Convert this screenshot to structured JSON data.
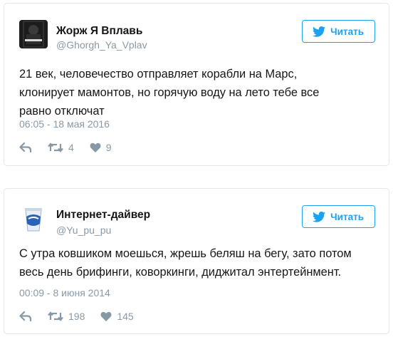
{
  "colors": {
    "accent": "#1da1f2",
    "muted": "#8899a6",
    "text": "#14171a",
    "border": "#e1e8ed"
  },
  "tweets": [
    {
      "name": "Жорж Я Вплавь",
      "handle": "@Ghorgh_Ya_Vplav",
      "follow_label": "Читать",
      "text_lines": [
        "21 век, человечество отправляет корабли на Марс,",
        "клонирует мамонтов, но горячую воду на лето тебе все",
        "равно отключат"
      ],
      "timestamp": "06:05 - 18 мая 2016",
      "retweets": "4",
      "likes": "9",
      "avatar_icon": "book-cover-avatar"
    },
    {
      "name": "Интернет-дайвер",
      "handle": "@Yu_pu_pu",
      "follow_label": "Читать",
      "text_lines": [
        "С утра ковшиком моешься, жрешь беляш на бегу, зато потом",
        "весь день брифинги, коворкинги, диджитал энтертейнмент."
      ],
      "timestamp": "00:09 - 8 июня 2014",
      "retweets": "198",
      "likes": "145",
      "avatar_icon": "yogurt-cup-avatar"
    }
  ]
}
